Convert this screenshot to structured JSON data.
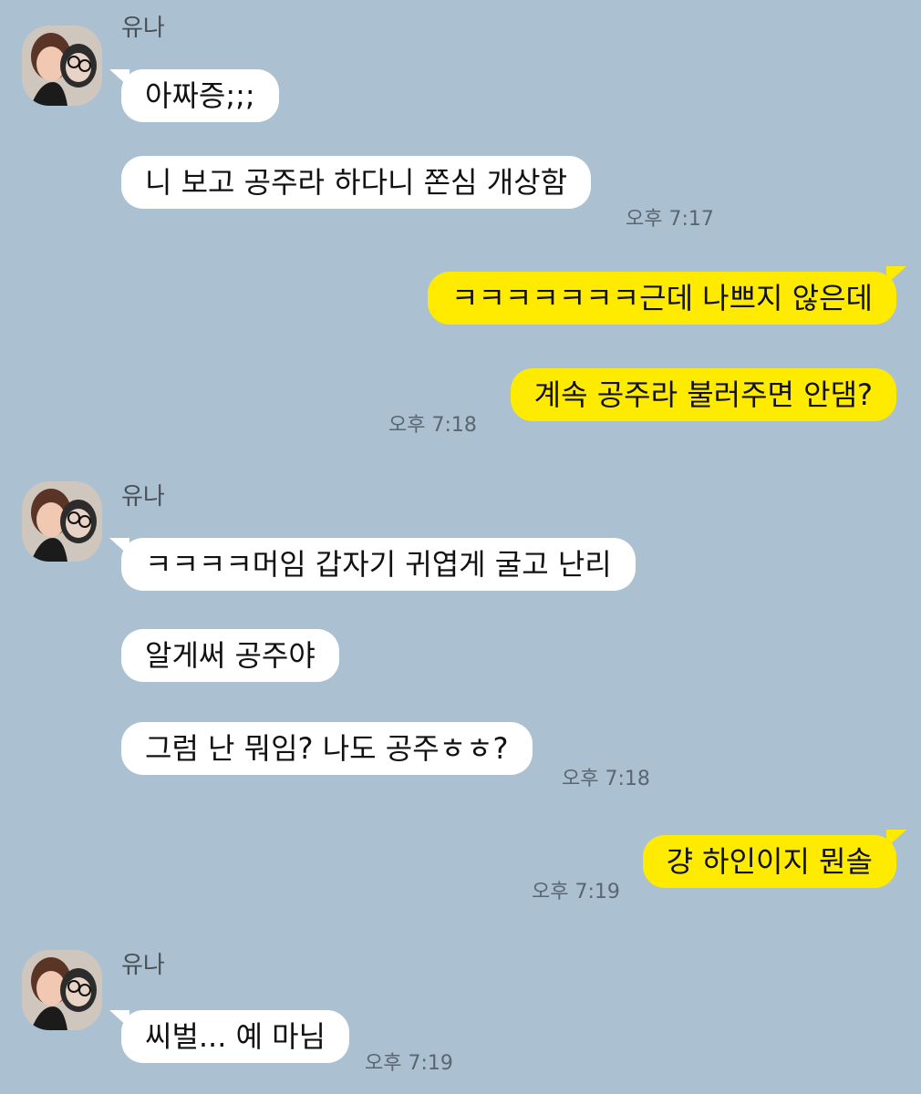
{
  "contact": {
    "name": "유나"
  },
  "messages": {
    "m1": "아짜증;;;",
    "m2": "니 보고 공주라 하다니 쫀심 개상함",
    "m3": "ㅋㅋㅋㅋㅋㅋㅋ근데 나쁘지 않은데",
    "m4": "계속 공주라 불러주면 안댐?",
    "m5": "ㅋㅋㅋㅋ머임 갑자기 귀엽게 굴고 난리",
    "m6": "알게써 공주야",
    "m7": "그럼 난 뭐임? 나도 공주ㅎㅎ?",
    "m8": "걍 하인이지 뭔솔",
    "m9": "씨벌... 예 마님"
  },
  "times": {
    "t1": "오후 7:17",
    "t2": "오후 7:18",
    "t3": "오후 7:18",
    "t4": "오후 7:19",
    "t5": "오후 7:19"
  },
  "colors": {
    "background": "#abc1d1",
    "incoming_bubble": "#ffffff",
    "outgoing_bubble": "#ffeb00"
  }
}
